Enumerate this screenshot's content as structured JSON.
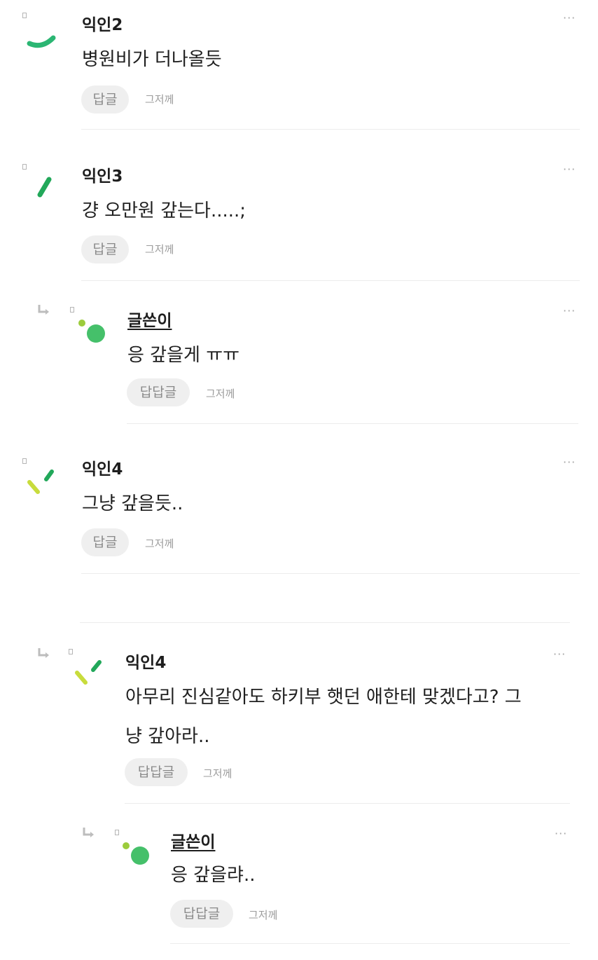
{
  "comments": [
    {
      "author": "익인2",
      "text": "병원비가 더나올듯",
      "reply_label": "답글",
      "time": "그저께",
      "more": "···"
    },
    {
      "author": "익인3",
      "text": "걍 오만원 갚는다.....;",
      "reply_label": "답글",
      "time": "그저께",
      "more": "···"
    },
    {
      "author": "글쓴이",
      "text": "응 갚을게 ㅠㅠ",
      "reply_label": "답답글",
      "time": "그저께",
      "more": "···"
    },
    {
      "author": "익인4",
      "text": "그냥 갚을듯..",
      "reply_label": "답글",
      "time": "그저께",
      "more": "···"
    },
    {
      "author": "익인4",
      "text_line1": "아무리 진심같아도 하키부 햇던 애한테 맞겠다고? 그",
      "text_line2": "냥 갚아라..",
      "reply_label": "답답글",
      "time": "그저께",
      "more": "···"
    },
    {
      "author": "글쓴이",
      "text": "응 갚을랴..",
      "reply_label": "답답글",
      "time": "그저께",
      "more": "···"
    }
  ],
  "colors": {
    "avatar_green": "#2bb673",
    "avatar_dark_green": "#22a85a",
    "avatar_lime": "#c8dc3c",
    "op_dot": "#45c06a",
    "op_small_dot": "#9ccc3c"
  },
  "icons": [
    "reply-arrow-icon",
    "more-options-icon",
    "avatar-icon"
  ]
}
